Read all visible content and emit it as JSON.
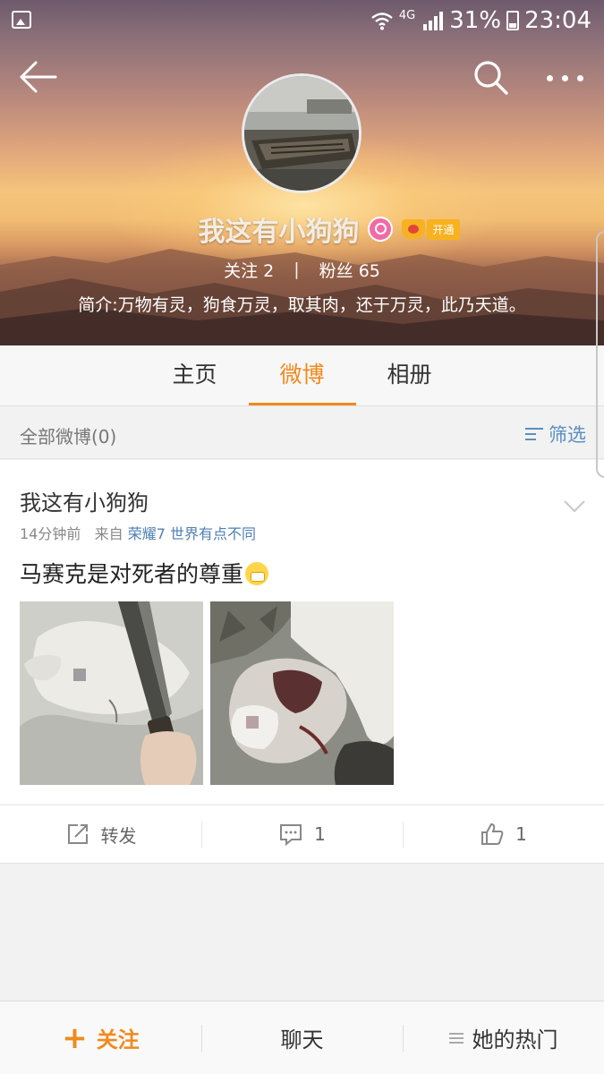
{
  "status_bar": {
    "network": "4G",
    "battery": "31%",
    "time": "23:04"
  },
  "profile": {
    "name": "我这有小狗狗",
    "vip_label": "开通",
    "following_label": "关注",
    "following_count": "2",
    "separator": "|",
    "fans_label": "粉丝",
    "fans_count": "65",
    "bio": "简介:万物有灵，狗食万灵，取其肉，还于万灵，此乃天道。"
  },
  "tabs": [
    {
      "label": "主页",
      "active": false
    },
    {
      "label": "微博",
      "active": true
    },
    {
      "label": "相册",
      "active": false
    }
  ],
  "filter": {
    "count_label": "全部微博(0)",
    "button_label": "筛选"
  },
  "post": {
    "author": "我这有小狗狗",
    "time": "14分钟前",
    "from_label": "来自",
    "source": "荣耀7 世界有点不同",
    "text": "马赛克是对死者的尊重",
    "actions": {
      "repost_label": "转发",
      "comment_count": "1",
      "like_count": "1"
    }
  },
  "bottom_bar": {
    "follow_label": "关注",
    "chat_label": "聊天",
    "hot_label": "她的热门"
  },
  "colors": {
    "accent": "#f08a1e",
    "link": "#4e7fb3",
    "female": "#f06ba6",
    "vip": "#f7b21f"
  }
}
